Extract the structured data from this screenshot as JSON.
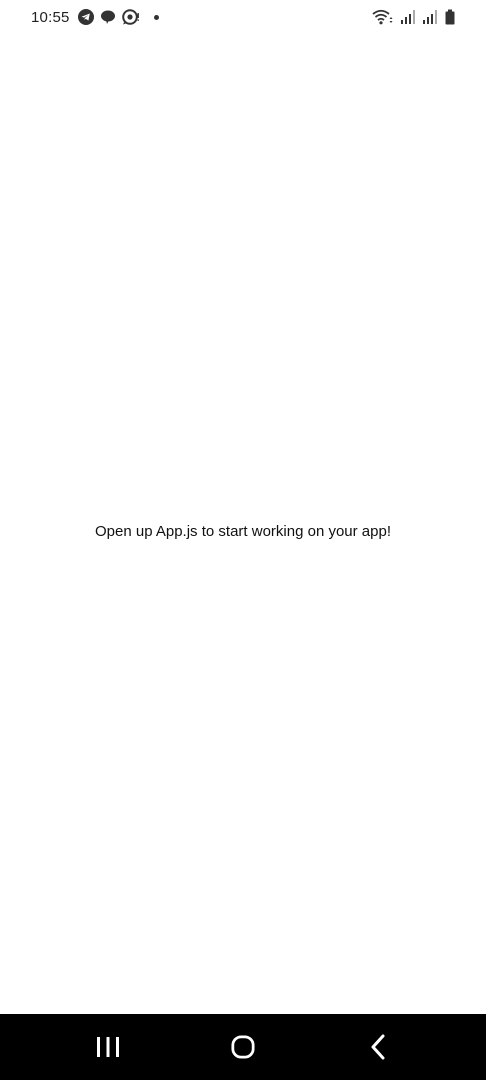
{
  "status_bar": {
    "time": "10:55",
    "left_icons": [
      "telegram-icon",
      "chat-bubble-icon",
      "messenger-icon",
      "notification-dot-icon"
    ],
    "right_icons": [
      "wifi-icon",
      "signal-sim1-icon",
      "signal-sim2-icon",
      "battery-icon"
    ]
  },
  "main": {
    "message": "Open up App.js to start working on your app!"
  },
  "nav_bar": {
    "buttons": [
      "recent-apps-icon",
      "home-icon",
      "back-icon"
    ]
  },
  "colors": {
    "background": "#ffffff",
    "text": "#111111",
    "nav_background": "#000000",
    "nav_icon": "#ffffff"
  }
}
